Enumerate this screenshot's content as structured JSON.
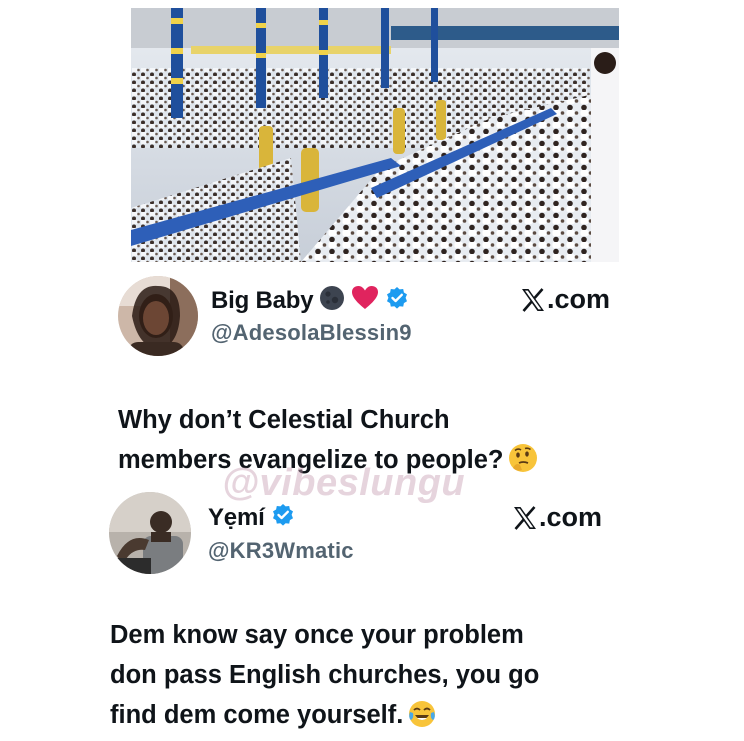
{
  "tweets": [
    {
      "name": "Big Baby",
      "handle": "@AdesolaBlessin9",
      "source": "X.com",
      "lines": [
        "Why don’t Celestial Church",
        "members evangelize to people?"
      ],
      "icons": [
        "dark-moon-emoji-icon",
        "red-heart-emoji-icon",
        "verified-badge-icon",
        "thinking-face-emoji-icon"
      ]
    },
    {
      "name": "Yẹmí",
      "handle": "@KR3Wmatic",
      "source": "X.com",
      "lines": [
        "Dem know say once your problem",
        "don pass English churches, you go",
        "find dem come yourself."
      ],
      "icons": [
        "verified-badge-icon",
        "tears-of-joy-emoji-icon"
      ]
    }
  ],
  "watermark": "@vibeslungu",
  "colors": {
    "text": "#0f1419",
    "handle": "#536471",
    "verified": "#1d9bf0",
    "heart": "#e0245e"
  }
}
